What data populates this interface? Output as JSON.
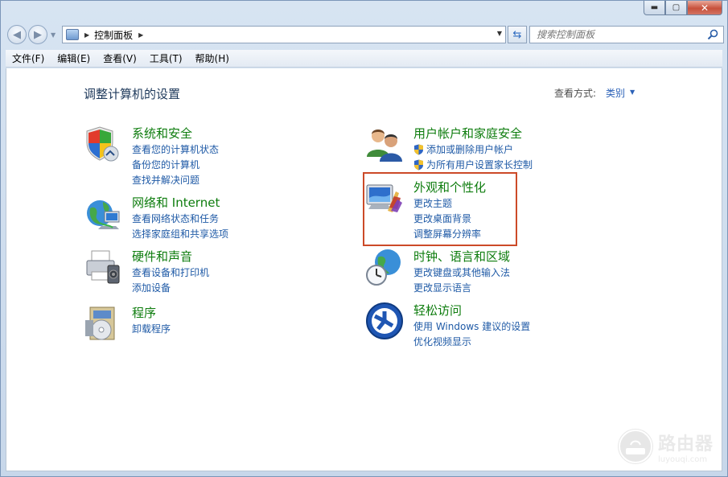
{
  "window": {
    "minimize_label": "▬",
    "maximize_label": "▢",
    "close_label": "✕"
  },
  "address": {
    "path": "控制面板",
    "separator": "▶"
  },
  "search": {
    "placeholder": "搜索控制面板"
  },
  "menu": [
    "文件(F)",
    "编辑(E)",
    "查看(V)",
    "工具(T)",
    "帮助(H)"
  ],
  "header": {
    "title": "调整计算机的设置",
    "view_by_label": "查看方式:",
    "view_by_value": "类别"
  },
  "categories": [
    {
      "id": "system-security",
      "title": "系统和安全",
      "icon": "shield-icon",
      "links": [
        {
          "label": "查看您的计算机状态",
          "shield": false
        },
        {
          "label": "备份您的计算机",
          "shield": false
        },
        {
          "label": "查找并解决问题",
          "shield": false
        }
      ]
    },
    {
      "id": "network",
      "title": "网络和 Internet",
      "icon": "network-globe-icon",
      "links": [
        {
          "label": "查看网络状态和任务",
          "shield": false
        },
        {
          "label": "选择家庭组和共享选项",
          "shield": false
        }
      ]
    },
    {
      "id": "hardware",
      "title": "硬件和声音",
      "icon": "printer-icon",
      "links": [
        {
          "label": "查看设备和打印机",
          "shield": false
        },
        {
          "label": "添加设备",
          "shield": false
        }
      ]
    },
    {
      "id": "programs",
      "title": "程序",
      "icon": "programs-disc-icon",
      "links": [
        {
          "label": "卸载程序",
          "shield": false
        }
      ]
    },
    {
      "id": "user-accounts",
      "title": "用户帐户和家庭安全",
      "icon": "users-icon",
      "links": [
        {
          "label": "添加或删除用户帐户",
          "shield": true
        },
        {
          "label": "为所有用户设置家长控制",
          "shield": true
        }
      ]
    },
    {
      "id": "appearance",
      "title": "外观和个性化",
      "icon": "monitor-palette-icon",
      "links": [
        {
          "label": "更改主题",
          "shield": false
        },
        {
          "label": "更改桌面背景",
          "shield": false
        },
        {
          "label": "调整屏幕分辨率",
          "shield": false
        }
      ]
    },
    {
      "id": "clock-region",
      "title": "时钟、语言和区域",
      "icon": "clock-globe-icon",
      "links": [
        {
          "label": "更改键盘或其他输入法",
          "shield": false
        },
        {
          "label": "更改显示语言",
          "shield": false
        }
      ]
    },
    {
      "id": "ease-of-access",
      "title": "轻松访问",
      "icon": "ease-of-access-icon",
      "links": [
        {
          "label": "使用 Windows 建议的设置",
          "shield": false
        },
        {
          "label": "优化视频显示",
          "shield": false
        }
      ]
    }
  ],
  "watermark": {
    "name": "路由器",
    "url": "luyouqi.com"
  },
  "colors": {
    "link": "#1f5aa6",
    "category_title": "#0d7c0d",
    "highlight": "#cc4a28"
  }
}
